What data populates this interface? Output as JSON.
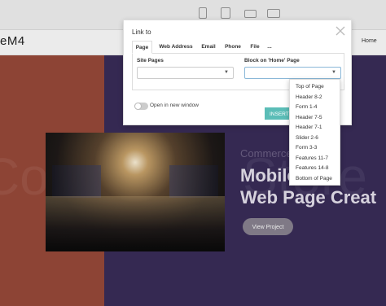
{
  "site": {
    "brand": "eM4",
    "nav_home": "Home"
  },
  "hero": {
    "background_word_left": "Com",
    "background_word_right": "Store",
    "subtitle": "Commerce Template",
    "title_line1": "Mobile",
    "title_line2": "Web Page Creat",
    "button": "View Project"
  },
  "dialog": {
    "title": "Link to",
    "tabs": [
      {
        "label": "Page",
        "active": true
      },
      {
        "label": "Web Address",
        "active": false
      },
      {
        "label": "Email",
        "active": false
      },
      {
        "label": "Phone",
        "active": false
      },
      {
        "label": "File",
        "active": false
      },
      {
        "label": "...",
        "active": false
      }
    ],
    "site_pages_label": "Site Pages",
    "site_pages_value": "",
    "block_label": "Block on 'Home' Page",
    "block_value": "",
    "open_new_window_label": "Open in new window",
    "open_new_window_on": false,
    "insert_button": "INSERT"
  },
  "block_options": [
    "Top of Page",
    "Header 8-2",
    "Form 1-4",
    "Header 7-5",
    "Header 7-1",
    "Slider 2-6",
    "Form 3-3",
    "Features 11-7",
    "Features 14-8",
    "Bottom of Page"
  ],
  "colors": {
    "hero_left": "#9a4a3a",
    "hero_right": "#3a2d5a",
    "accent": "#5bbdb7"
  },
  "icons": {
    "close": "close-icon",
    "devices": [
      "mobile-icon",
      "tablet-icon",
      "laptop-icon",
      "desktop-icon"
    ]
  }
}
